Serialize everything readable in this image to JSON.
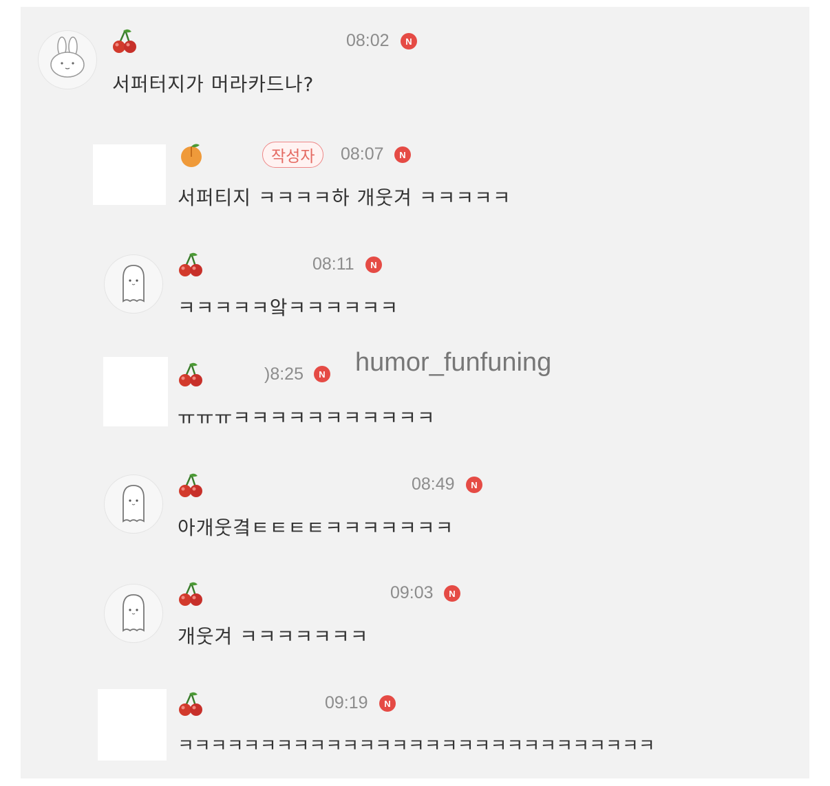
{
  "watermark": "humor_funfuning",
  "badge_new": "N",
  "comments": [
    {
      "time": "08:02",
      "text": "서퍼터지가 머라카드나?",
      "nick_icon": "cherry-icon",
      "avatar": "rabbit-avatar"
    },
    {
      "time": "08:07",
      "text": "서퍼티지 ㅋㅋㅋㅋ하 개웃겨 ㅋㅋㅋㅋㅋ",
      "nick_icon": "orange-icon",
      "avatar": "blank-avatar",
      "badge": "작성자"
    },
    {
      "time": "08:11",
      "text": "ㅋㅋㅋㅋㅋ앜ㅋㅋㅋㅋㅋㅋ",
      "nick_icon": "cherry-icon",
      "avatar": "ghost-avatar"
    },
    {
      "time": ")8:25",
      "text": "ㅠㅠㅠㅋㅋㅋㅋㅋㅋㅋㅋㅋㅋㅋ",
      "nick_icon": "cherry-icon",
      "avatar": "blank-avatar"
    },
    {
      "time": "08:49",
      "text": "아개웃곀ㅌㅌㅌㅌㅋㅋㅋㅋㅋㅋㅋ",
      "nick_icon": "cherry-icon",
      "avatar": "ghost-avatar"
    },
    {
      "time": "09:03",
      "text": "개웃겨 ㅋㅋㅋㅋㅋㅋㅋ",
      "nick_icon": "cherry-icon",
      "avatar": "ghost-avatar"
    },
    {
      "time": "09:19",
      "text": "ㅋㅋㅋㅋㅋㅋㅋㅋㅋㅋㅋㅋㅋㅋㅋㅋㅋㅋㅋㅋㅋㅋㅋㅋㅋㅋㅋㅋㅋ",
      "nick_icon": "cherry-icon",
      "avatar": "blank-avatar"
    }
  ]
}
